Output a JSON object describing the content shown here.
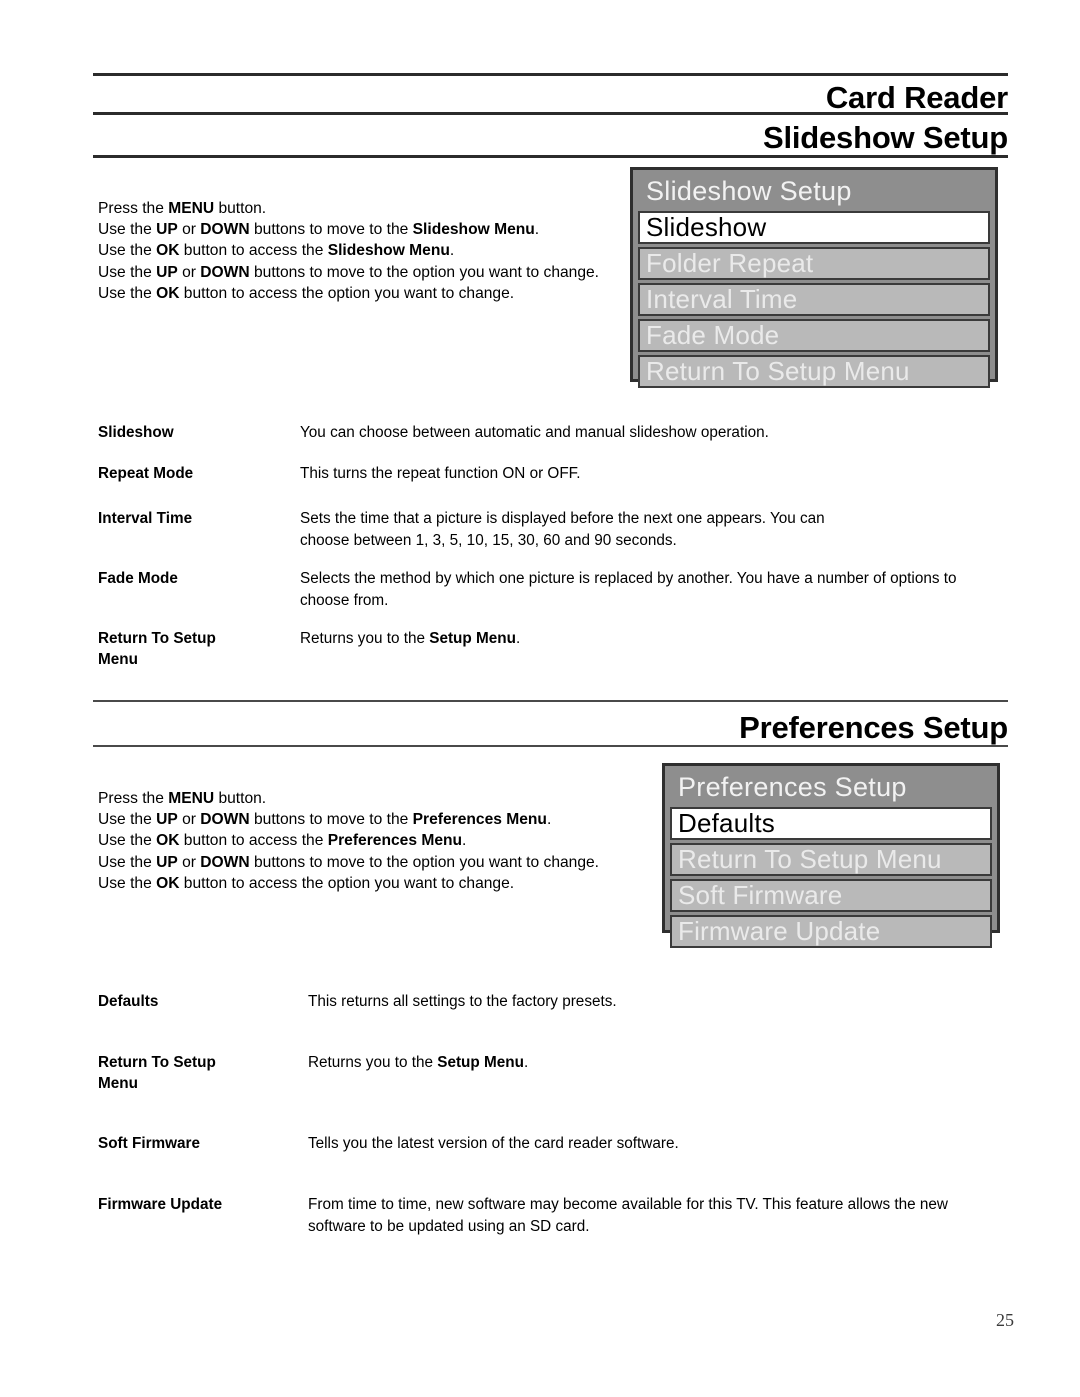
{
  "document": {
    "header_title": "Card Reader",
    "page_number": "25"
  },
  "sections": [
    {
      "heading": "Slideshow Setup",
      "steps": [
        "Press the MENU button.",
        "Use the UP or DOWN buttons to move to the Slideshow Menu.",
        "Use the OK button to access the Slideshow Menu.",
        "Use the UP or DOWN buttons to move to the option you want to change.",
        "Use the OK button to access the option you want to change."
      ],
      "osd": {
        "title": "Slideshow Setup",
        "items": [
          {
            "label": "Slideshow",
            "selected": true
          },
          {
            "label": "Folder Repeat",
            "selected": false
          },
          {
            "label": "Interval Time",
            "selected": false
          },
          {
            "label": "Fade Mode",
            "selected": false
          },
          {
            "label": "Return To Setup Menu",
            "selected": false
          }
        ]
      },
      "definitions": [
        {
          "term": "Slideshow",
          "desc": "You can choose between automatic and manual slideshow operation."
        },
        {
          "term": "Repeat Mode",
          "desc": "This turns the repeat function ON or OFF."
        },
        {
          "term": "Interval Time",
          "desc": "Sets the time that a picture is displayed before the next one appears. You can choose between 1, 3, 5, 10, 15, 30, 60 and 90 seconds."
        },
        {
          "term": "Fade Mode",
          "desc": "Selects the method by which one picture is replaced by another. You have a number of options to choose from."
        },
        {
          "term": "Return To Setup Menu",
          "desc": "Returns you to the Setup Menu."
        }
      ]
    },
    {
      "heading": "Preferences Setup",
      "steps": [
        "Press the MENU button.",
        "Use the UP or DOWN buttons to move to the Preferences Menu.",
        "Use the OK button to access the Preferences Menu.",
        "Use the UP or DOWN buttons to move to the option you want to change.",
        "Use the OK button to access the option you want to change."
      ],
      "osd": {
        "title": "Preferences Setup",
        "items": [
          {
            "label": "Defaults",
            "selected": true
          },
          {
            "label": "Return To Setup Menu",
            "selected": false
          },
          {
            "label": "Soft Firmware",
            "selected": false
          },
          {
            "label": "Firmware Update",
            "selected": false
          }
        ]
      },
      "definitions": [
        {
          "term": "Defaults",
          "desc": "This returns all settings to the factory presets."
        },
        {
          "term": "Return To Setup Menu",
          "desc": "Returns you to the Setup Menu."
        },
        {
          "term": "Soft Firmware",
          "desc": "Tells you the latest version of the card reader software."
        },
        {
          "term": "Firmware Update",
          "desc": "From time to time, new software may become available for this TV. This feature allows the new software to be updated using an SD card."
        }
      ]
    }
  ],
  "colors": {
    "rule": "#2b2b2b",
    "osd_background": "#8e8e8e",
    "osd_item_background": "#b9b9b9",
    "osd_item_selected_background": "#ffffff",
    "osd_text": "#eaeaea",
    "osd_selected_text": "#000000"
  }
}
